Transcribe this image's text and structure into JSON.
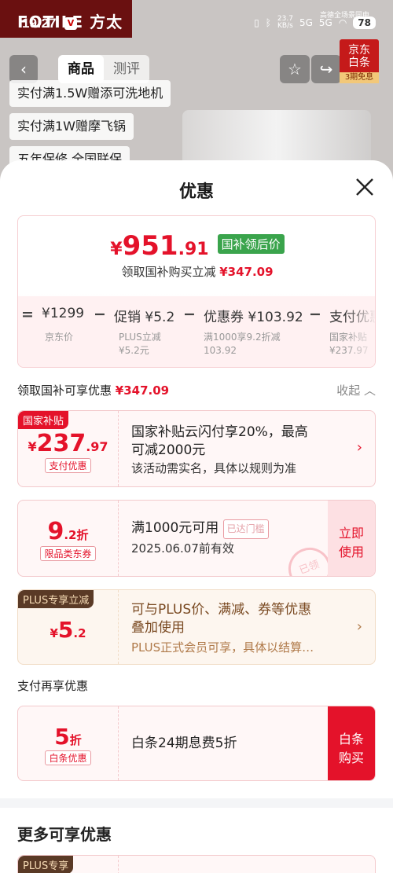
{
  "status": {
    "time": "19:27",
    "app_badge": "V",
    "speed_top": "23.7",
    "speed_unit": "KB/s",
    "net1": "5G",
    "net2": "5G",
    "battery": "78",
    "subtitle": "高德全场景同电"
  },
  "background": {
    "brand": "FOTILE 方太",
    "tabs": [
      "商品",
      "测评"
    ],
    "jd_badge": {
      "line1": "京东",
      "line2": "白条",
      "line3": "3期免息"
    },
    "promo_lines": [
      "实付满1.5W赠添可洗地机",
      "实付满1W赠摩飞锅",
      "五年保修 全国联保"
    ]
  },
  "sheet": {
    "title": "优惠",
    "final_price": {
      "currency": "¥",
      "integer": "951",
      "decimal": ".91",
      "tag": "国补领后价"
    },
    "subline": {
      "text": "领取国补购买立减",
      "amount": "¥347.09"
    },
    "formula": {
      "eq": "=",
      "minus": "−",
      "items": [
        {
          "main": "¥1299",
          "sub": "京东价",
          "sub2": ""
        },
        {
          "main": "促销 ¥5.2",
          "sub": "PLUS立减",
          "sub2": "¥5.2元"
        },
        {
          "main": "优惠券 ¥103.92",
          "sub": "满1000享9.2折减",
          "sub2": "103.92"
        },
        {
          "main": "支付优惠",
          "sub": "国家补贴",
          "sub2": "¥237.97"
        }
      ]
    },
    "section1": {
      "label": "领取国补可享优惠",
      "amount": "¥347.09",
      "collapse": "收起"
    },
    "cards": {
      "subsidy": {
        "ribbon": "国家补贴",
        "currency": "¥",
        "integer": "237",
        "decimal": ".97",
        "pill": "支付优惠",
        "desc_line1": "国家补贴云闪付享20%，最高",
        "desc_line2": "可减2000元",
        "note": "该活动需实名，具体以规则为准"
      },
      "coupon": {
        "integer": "9",
        "decimal": ".2折",
        "pill": "限品类东券",
        "desc": "满1000元可用",
        "reached": "已达门槛",
        "expire": "2025.06.07前有效",
        "btn_line1": "立即",
        "btn_line2": "使用",
        "stamp": "已领"
      },
      "plus": {
        "ribbon": "PLUS专享立减",
        "currency": "¥",
        "integer": "5",
        "decimal": ".2",
        "desc_line1": "可与PLUS价、满减、券等优惠",
        "desc_line2": "叠加使用",
        "note": "PLUS正式会员可享，具体以结算…"
      },
      "baitiao": {
        "integer": "5",
        "unit": "折",
        "pill": "白条优惠",
        "desc": "白条24期息费5折",
        "btn_line1": "白条",
        "btn_line2": "购买"
      },
      "plus2": {
        "ribbon": "PLUS专享"
      }
    },
    "section2": "支付再享优惠",
    "section3": "更多可享优惠"
  },
  "colors": {
    "accent": "#e4122a",
    "green_tag": "#3aa44c",
    "plus_brown": "#5a3a26"
  }
}
